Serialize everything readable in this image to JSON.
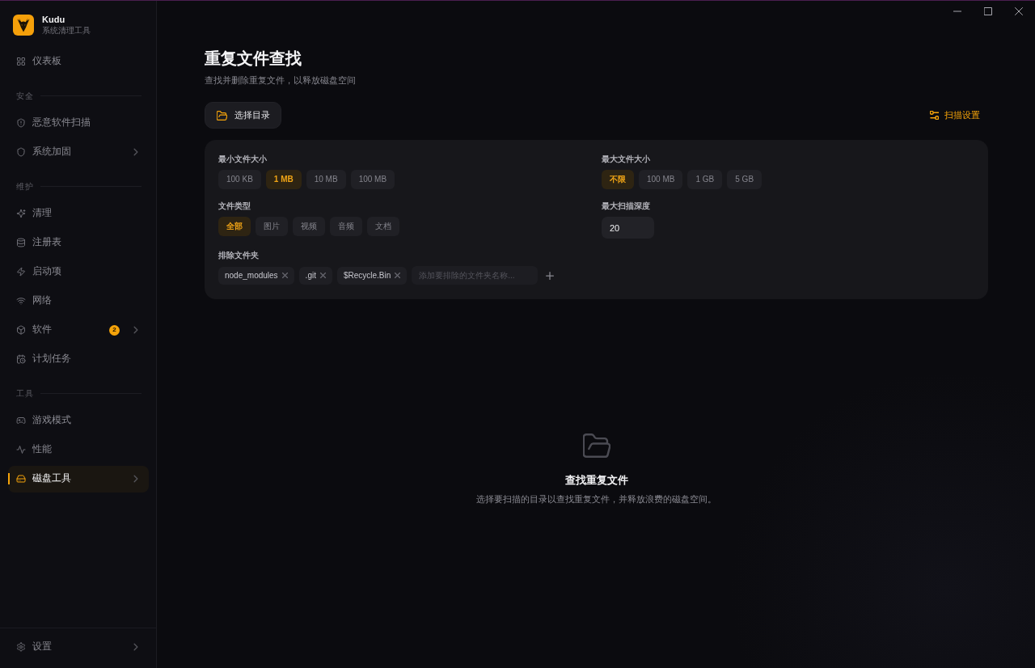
{
  "app": {
    "name": "Kudu",
    "tagline": "系统清理工具"
  },
  "sidebar": {
    "top_items": [
      {
        "label": "仪表板",
        "selected": false,
        "submenu": false
      }
    ],
    "groups": [
      {
        "heading": "安全",
        "items": [
          {
            "label": "恶意软件扫描",
            "selected": false,
            "submenu": false
          },
          {
            "label": "系统加固",
            "selected": false,
            "submenu": true
          }
        ]
      },
      {
        "heading": "维护",
        "items": [
          {
            "label": "清理",
            "selected": false,
            "submenu": false
          },
          {
            "label": "注册表",
            "selected": false,
            "submenu": false
          },
          {
            "label": "启动项",
            "selected": false,
            "submenu": false
          },
          {
            "label": "网络",
            "selected": false,
            "submenu": false
          },
          {
            "label": "软件",
            "selected": false,
            "submenu": true,
            "badge": "2"
          },
          {
            "label": "计划任务",
            "selected": false,
            "submenu": false
          }
        ]
      },
      {
        "heading": "工具",
        "items": [
          {
            "label": "游戏模式",
            "selected": false,
            "submenu": false
          },
          {
            "label": "性能",
            "selected": false,
            "submenu": false
          },
          {
            "label": "磁盘工具",
            "selected": true,
            "submenu": true
          }
        ]
      }
    ],
    "footer_items": [
      {
        "label": "设置",
        "selected": false,
        "submenu": true
      }
    ]
  },
  "page": {
    "title": "重复文件查找",
    "subtitle": "查找并删除重复文件，以释放磁盘空间"
  },
  "toolbar": {
    "choose_directory": "选择目录",
    "scan_settings": "扫描设置"
  },
  "filters": {
    "min_size": {
      "label": "最小文件大小",
      "options": [
        {
          "label": "100 KB",
          "selected": false
        },
        {
          "label": "1 MB",
          "selected": true
        },
        {
          "label": "10 MB",
          "selected": false
        },
        {
          "label": "100 MB",
          "selected": false
        }
      ]
    },
    "max_size": {
      "label": "最大文件大小",
      "options": [
        {
          "label": "不限",
          "selected": true
        },
        {
          "label": "100 MB",
          "selected": false
        },
        {
          "label": "1 GB",
          "selected": false
        },
        {
          "label": "5 GB",
          "selected": false
        }
      ]
    },
    "file_type": {
      "label": "文件类型",
      "options": [
        {
          "label": "全部",
          "selected": true
        },
        {
          "label": "图片",
          "selected": false
        },
        {
          "label": "视频",
          "selected": false
        },
        {
          "label": "音频",
          "selected": false
        },
        {
          "label": "文档",
          "selected": false
        }
      ]
    },
    "max_depth": {
      "label": "最大扫描深度",
      "value": "20"
    },
    "excluded": {
      "label": "排除文件夹",
      "tags": [
        "node_modules",
        ".git",
        "$Recycle.Bin"
      ],
      "placeholder": "添加要排除的文件夹名称..."
    }
  },
  "empty_state": {
    "title": "查找重复文件",
    "message": "选择要扫描的目录以查找重复文件，并释放浪费的磁盘空间。"
  }
}
